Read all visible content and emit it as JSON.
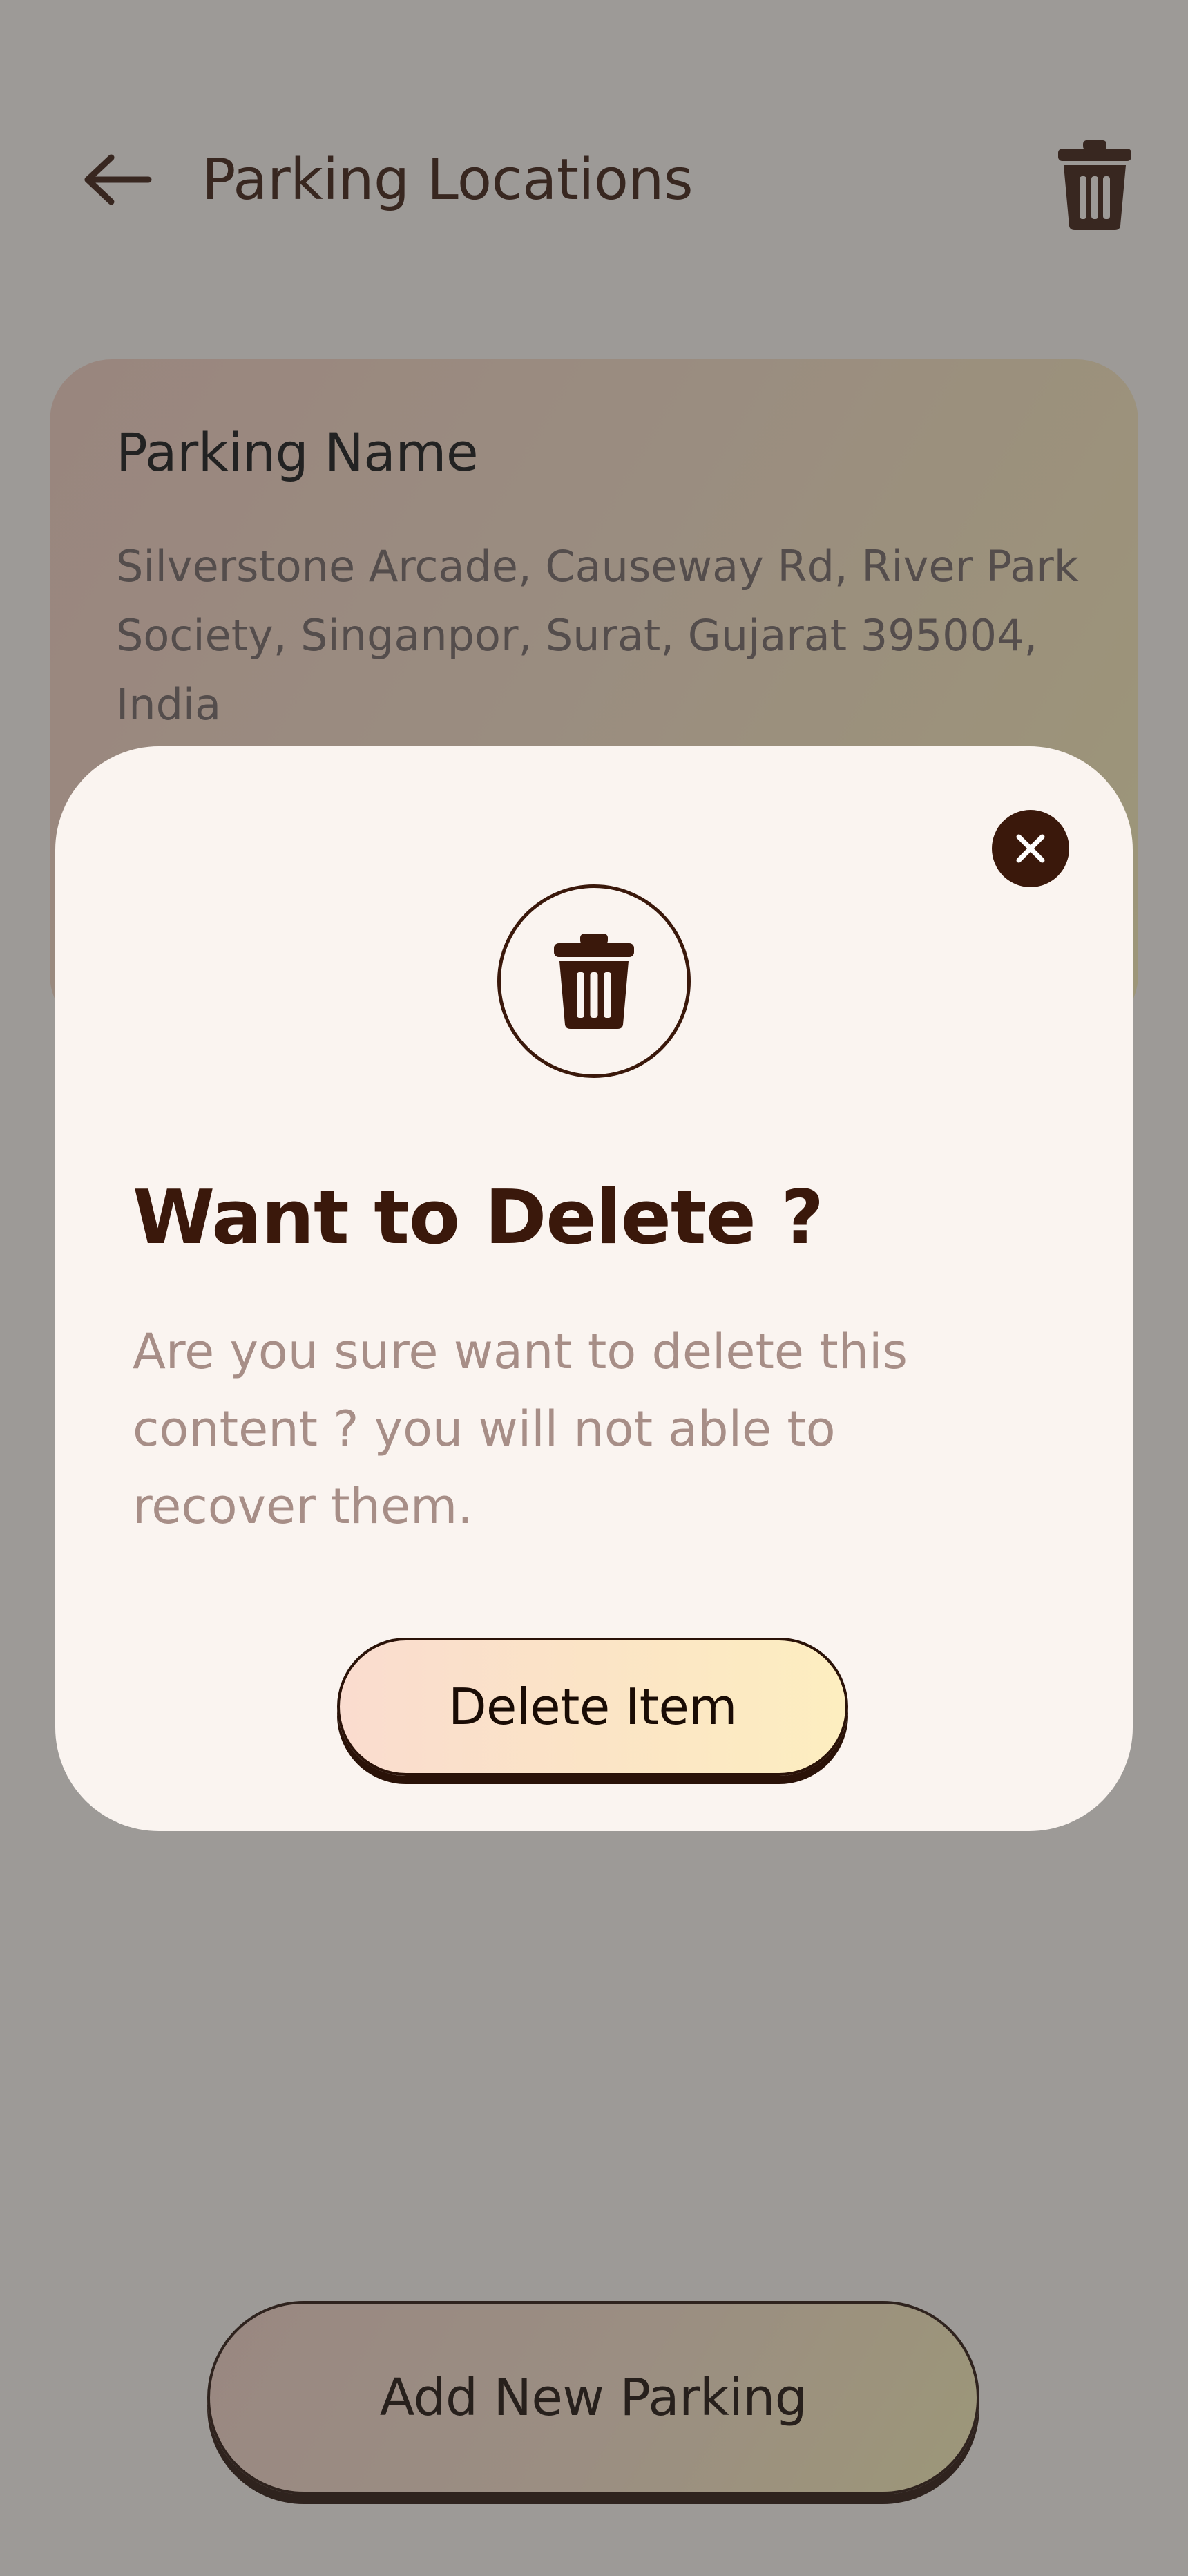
{
  "header": {
    "title": "Parking Locations",
    "back_icon": "arrow-left-icon",
    "delete_icon": "trash-icon"
  },
  "parking_card": {
    "name": "Parking Name",
    "address": "Silverstone Arcade, Causeway Rd, River Park Society, Singanpor, Surat, Gujarat 395004, India"
  },
  "footer": {
    "add_label": "Add New Parking"
  },
  "dialog": {
    "title": "Want to Delete ?",
    "body": "Are you sure want to delete this content ? you will not able to recover them.",
    "delete_label": "Delete Item",
    "close_icon": "close-icon",
    "hero_icon": "trash-icon"
  },
  "colors": {
    "primary_dark": "#3a180b",
    "background": "#faf4f0",
    "muted_text": "#a78e87",
    "overlay": "rgba(55,55,55,0.48)"
  }
}
